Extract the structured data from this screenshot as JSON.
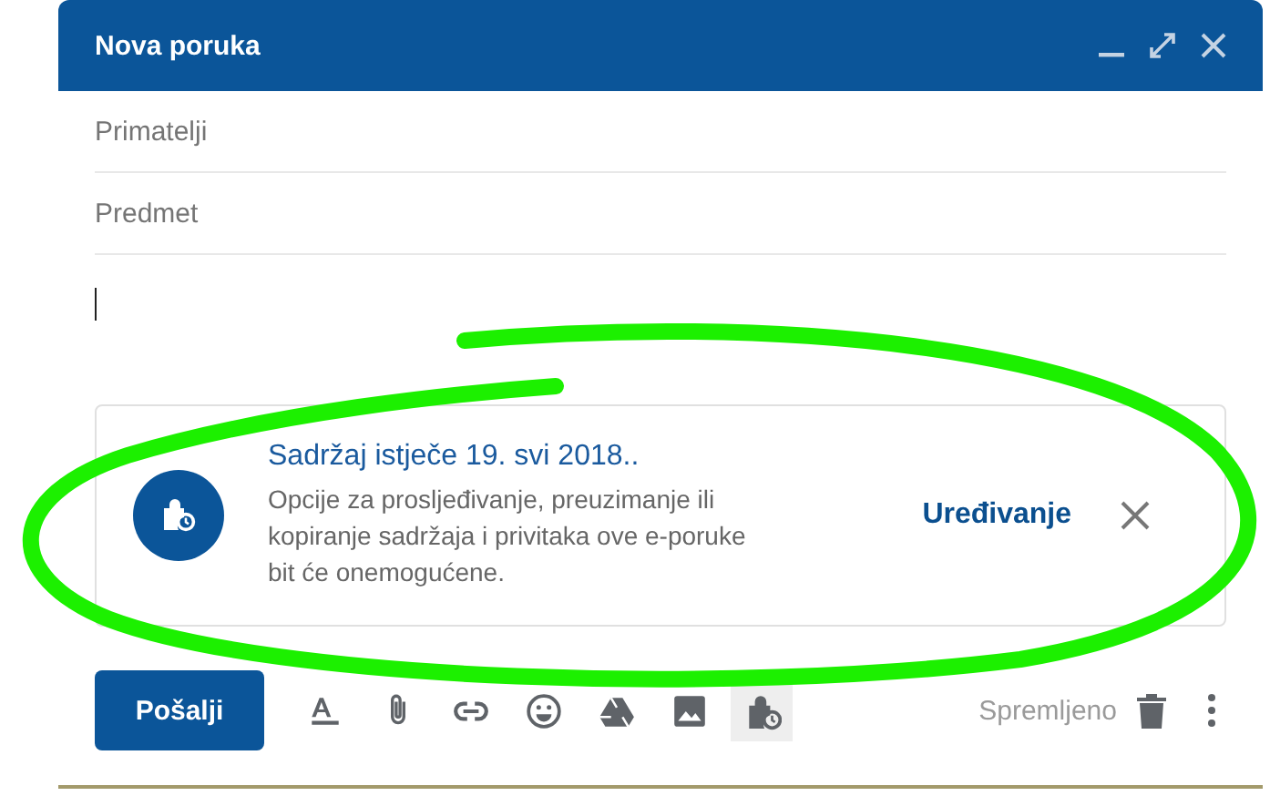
{
  "window": {
    "title": "Nova poruka"
  },
  "fields": [
    {
      "placeholder": "Primatelji"
    },
    {
      "placeholder": "Predmet"
    }
  ],
  "notice": {
    "title": "Sadržaj istječe 19. svi 2018..",
    "body": "Opcije za prosljeđivanje, preuzimanje ili kopiranje sadržaja i privitaka ove e-poruke bit će onemogućene.",
    "action": "Uređivanje"
  },
  "toolbar": {
    "send": "Pošalji",
    "tools": [
      {
        "kind": "format",
        "selected": false
      },
      {
        "kind": "attach",
        "selected": false
      },
      {
        "kind": "link",
        "selected": false
      },
      {
        "kind": "emoji",
        "selected": false
      },
      {
        "kind": "drive",
        "selected": false
      },
      {
        "kind": "photo",
        "selected": false
      },
      {
        "kind": "confidential",
        "selected": true
      }
    ],
    "status": "Spremljeno"
  }
}
